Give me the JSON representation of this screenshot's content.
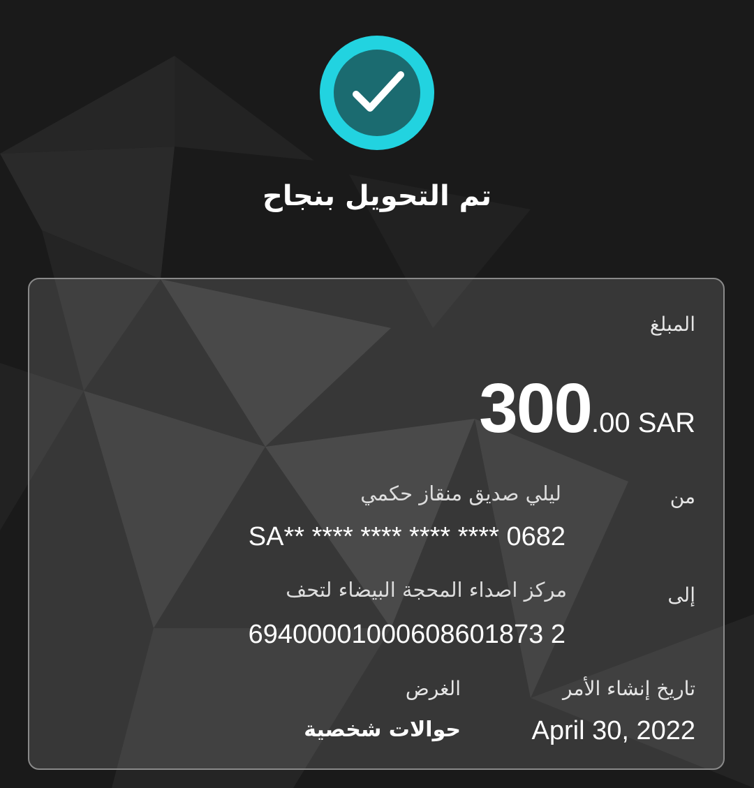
{
  "header": {
    "status_icon": "check-circle-icon",
    "title": "تم التحويل بنجاح",
    "accent_color": "#22d3e0",
    "icon_inner_color": "#1b6b70"
  },
  "card": {
    "amount_label": "المبلغ",
    "amount_integer": "300",
    "amount_decimal": ".00",
    "currency": "SAR",
    "from_label": "من",
    "from_name": "ليلي صديق منقاز حكمي",
    "from_account": "SA** **** **** **** **** 0682",
    "to_label": "إلى",
    "to_name": "مركز اصداء المحجة البيضاء لتحف",
    "to_account": "69400001000608601873 2",
    "date_label": "تاريخ إنشاء الأمر",
    "date_value": "April 30, 2022",
    "purpose_label": "الغرض",
    "purpose_value": "حوالات شخصية"
  }
}
